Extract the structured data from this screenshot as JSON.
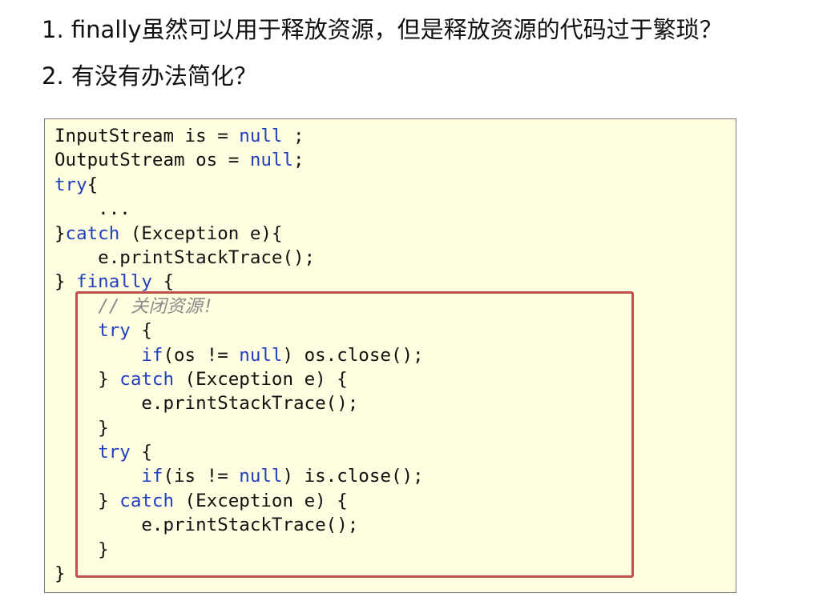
{
  "questions": [
    "1. finally虽然可以用于释放资源，但是释放资源的代码过于繁琐？",
    "2. 有没有办法简化？"
  ],
  "code": {
    "lines": [
      [
        {
          "t": "InputStream is = "
        },
        {
          "t": "null",
          "c": "kw"
        },
        {
          "t": " ;"
        }
      ],
      [
        {
          "t": "OutputStream os = "
        },
        {
          "t": "null",
          "c": "kw"
        },
        {
          "t": ";"
        }
      ],
      [
        {
          "t": "try",
          "c": "kw"
        },
        {
          "t": "{"
        }
      ],
      [
        {
          "t": "    ..."
        }
      ],
      [
        {
          "t": "}"
        },
        {
          "t": "catch",
          "c": "kw"
        },
        {
          "t": " (Exception e){"
        }
      ],
      [
        {
          "t": "    e.printStackTrace();"
        }
      ],
      [
        {
          "t": "} "
        },
        {
          "t": "finally",
          "c": "kw"
        },
        {
          "t": " {"
        }
      ],
      [
        {
          "t": "    "
        },
        {
          "t": "// 关闭资源!",
          "c": "cm"
        }
      ],
      [
        {
          "t": "    "
        },
        {
          "t": "try",
          "c": "kw"
        },
        {
          "t": " {"
        }
      ],
      [
        {
          "t": "        "
        },
        {
          "t": "if",
          "c": "kw"
        },
        {
          "t": "(os != "
        },
        {
          "t": "null",
          "c": "kw"
        },
        {
          "t": ") os.close();"
        }
      ],
      [
        {
          "t": "    } "
        },
        {
          "t": "catch",
          "c": "kw"
        },
        {
          "t": " (Exception e) {"
        }
      ],
      [
        {
          "t": "        e.printStackTrace();"
        }
      ],
      [
        {
          "t": "    }"
        }
      ],
      [
        {
          "t": "    "
        },
        {
          "t": "try",
          "c": "kw"
        },
        {
          "t": " {"
        }
      ],
      [
        {
          "t": "        "
        },
        {
          "t": "if",
          "c": "kw"
        },
        {
          "t": "(is != "
        },
        {
          "t": "null",
          "c": "kw"
        },
        {
          "t": ") is.close();"
        }
      ],
      [
        {
          "t": "    } "
        },
        {
          "t": "catch",
          "c": "kw"
        },
        {
          "t": " (Exception e) {"
        }
      ],
      [
        {
          "t": "        e.printStackTrace();"
        }
      ],
      [
        {
          "t": "    }"
        }
      ],
      [
        {
          "t": "}"
        }
      ]
    ]
  },
  "colors": {
    "keyword": "#1f3fbf",
    "comment": "#8a8a8a",
    "code_background": "#fffee0",
    "highlight_border": "#c0504d"
  }
}
